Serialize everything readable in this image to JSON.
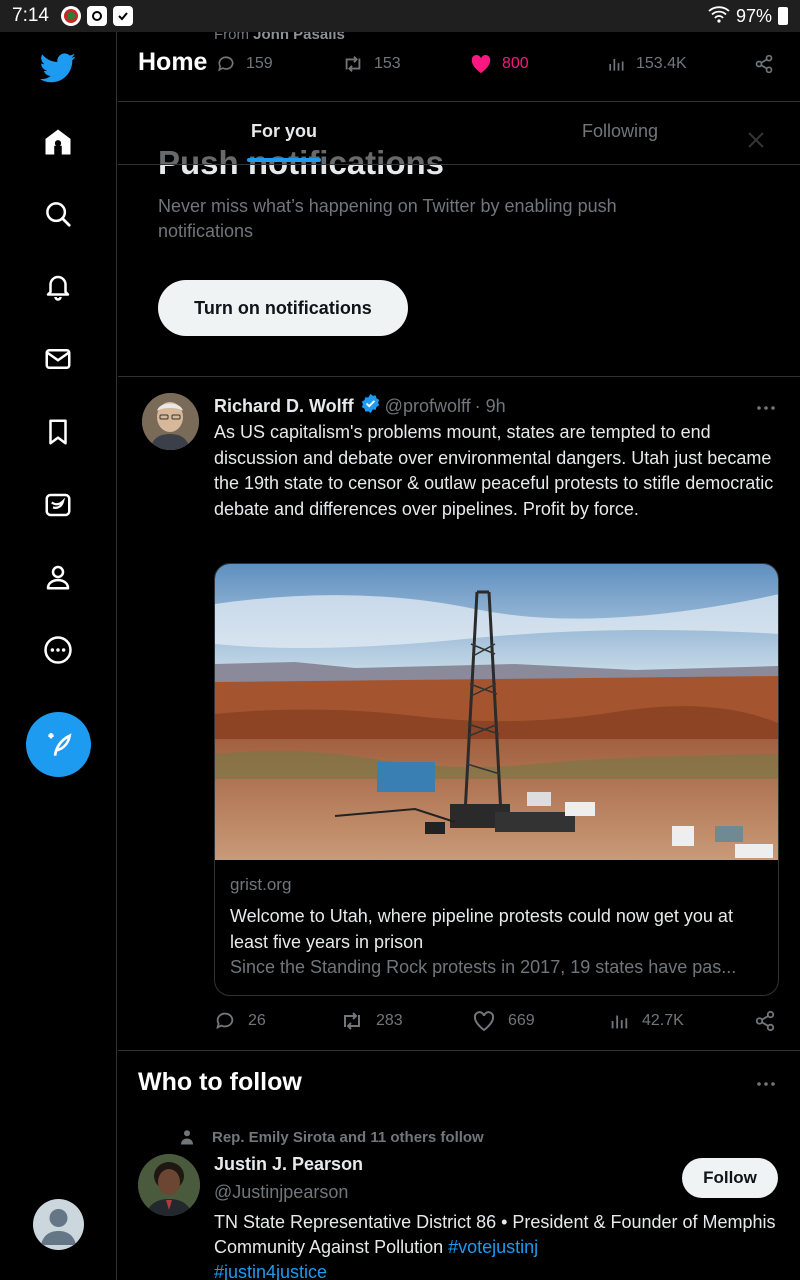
{
  "status_bar": {
    "time": "7:14",
    "battery": "97%"
  },
  "nav": {
    "items": [
      "home",
      "explore",
      "notifications",
      "messages",
      "bookmarks",
      "twitter-blue",
      "profile",
      "more"
    ]
  },
  "ghost_tweet": {
    "from_prefix": "From",
    "from_name": "John Pasalis",
    "replies": "159",
    "retweets": "153",
    "likes": "800",
    "views": "153.4K"
  },
  "header": {
    "title": "Home",
    "tabs": [
      {
        "label": "For you"
      },
      {
        "label": "Following"
      }
    ]
  },
  "push_prompt": {
    "title": "Push notifications",
    "description": "Never miss what’s happening on Twitter by enabling push notifications",
    "button": "Turn on notifications"
  },
  "tweet": {
    "author_name": "Richard D. Wolff",
    "author_handle": "@profwolff",
    "time": "· 9h",
    "text": "As US capitalism's problems mount, states are tempted to end discussion and debate over environmental dangers. Utah just became the 19th state to censor & outlaw peaceful protests to stifle democratic debate and differences over pipelines. Profit by force.",
    "card": {
      "domain": "grist.org",
      "title": "Welcome to Utah, where pipeline protests could now get you at least five years in prison",
      "description": "Since the Standing Rock protests in 2017, 19 states have pas..."
    },
    "replies": "26",
    "retweets": "283",
    "likes": "669",
    "views": "42.7K"
  },
  "who_to_follow": {
    "title": "Who to follow",
    "social_context": "Rep. Emily Sirota and 11 others follow",
    "name": "Justin J. Pearson",
    "handle": "@Justinjpearson",
    "follow_label": "Follow",
    "bio_text": "TN State Representative District 86 • President & Founder of Memphis Community Against Pollution ",
    "bio_link1": "#votejustinj",
    "bio_link2": "#justin4justice"
  },
  "colors": {
    "accent": "#1d9bf0",
    "like": "#f91880",
    "background": "#000000",
    "muted": "#71767b"
  }
}
